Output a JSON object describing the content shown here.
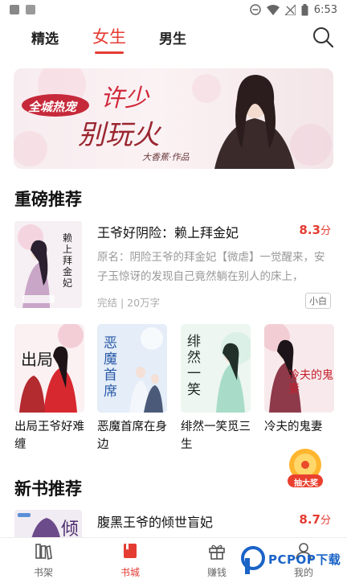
{
  "status_bar": {
    "time": "6:53"
  },
  "top_nav": {
    "tabs": [
      {
        "label": "精选",
        "active": false
      },
      {
        "label": "女生",
        "active": true
      },
      {
        "label": "男生",
        "active": false
      }
    ]
  },
  "banner": {
    "tag": "全城热宠",
    "title_line1": "许少",
    "title_line2": "别玩火",
    "author": "大香蕉·作品"
  },
  "sections": {
    "featured_title": "重磅推荐",
    "new_books_title": "新书推荐"
  },
  "featured_book": {
    "title": "王爷好阴险：赖上拜金妃",
    "score": "8.3",
    "score_unit": "分",
    "description": "原名：阴险王爷的拜金妃【微虐】一觉醒来，安子玉惊讶的发现自己竟然躺在别人的床上，",
    "meta": "完结 | 20万字",
    "tag": "小白",
    "cover_text": "赖上拜金妃"
  },
  "grid_books": [
    {
      "title": "出局王爷好难缠",
      "cover_text": "出局"
    },
    {
      "title": "恶魔首席在身边",
      "cover_text": "恶魔首席"
    },
    {
      "title": "绯然一笑觅三生",
      "cover_text": "绯然一笑"
    },
    {
      "title": "冷夫的鬼妻",
      "cover_text": "冷夫的鬼妻"
    }
  ],
  "float_badge": {
    "label": "抽大奖"
  },
  "new_book": {
    "title": "腹黑王爷的倾世盲妃",
    "score": "8.7",
    "score_unit": "分",
    "cover_text": "倾"
  },
  "bottom_nav": [
    {
      "label": "书架",
      "icon": "bookshelf-icon",
      "active": false
    },
    {
      "label": "书城",
      "icon": "bookstore-icon",
      "active": true
    },
    {
      "label": "赚钱",
      "icon": "gift-icon",
      "active": false
    },
    {
      "label": "我的",
      "icon": "profile-icon",
      "active": false
    }
  ],
  "watermark": {
    "text": "PCPOP下载"
  },
  "colors": {
    "accent": "#e43c33",
    "text_dark": "#111111",
    "text_muted": "#999999"
  }
}
